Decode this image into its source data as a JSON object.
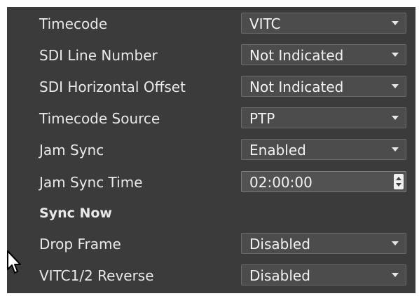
{
  "settings": {
    "rows": [
      {
        "label": "Timecode",
        "value": "VITC"
      },
      {
        "label": "SDI Line Number",
        "value": "Not Indicated"
      },
      {
        "label": "SDI Horizontal Offset",
        "value": "Not Indicated"
      },
      {
        "label": "Timecode Source",
        "value": "PTP"
      },
      {
        "label": "Jam Sync",
        "value": "Enabled"
      },
      {
        "label": "Jam Sync Time",
        "value": "02:00:00"
      },
      {
        "label": "Sync Now"
      },
      {
        "label": "Drop Frame",
        "value": "Disabled"
      },
      {
        "label": "VITC1/2 Reverse",
        "value": "Disabled"
      }
    ]
  },
  "icons": {
    "dropdown": "chevron-down-icon",
    "spinner": "spinner-arrows-icon",
    "cursor": "mouse-pointer-icon"
  },
  "colors": {
    "panel_background": "#3b3b3b",
    "control_background": "#4c4c4c",
    "text": "#e9e9e9"
  }
}
